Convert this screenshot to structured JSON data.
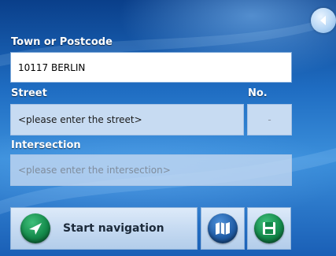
{
  "form": {
    "town_label": "Town or Postcode",
    "town_value": "10117 BERLIN",
    "street_label": "Street",
    "number_label": "No.",
    "street_placeholder": "<please enter the street>",
    "number_value": "-",
    "intersection_label": "Intersection",
    "intersection_placeholder": "<please enter the intersection>"
  },
  "actions": {
    "start_navigation_label": "Start navigation",
    "start_navigation_icon": "navigation-arrow-icon",
    "map_icon": "map-icon",
    "save_icon": "save-icon",
    "back_icon": "back-arrow-icon"
  },
  "colors": {
    "background": "#1f6dc2",
    "field_active": "#ffffff",
    "field_inactive": "#c7dbf2",
    "accent_green": "#148a4b",
    "accent_blue": "#215ea8"
  }
}
